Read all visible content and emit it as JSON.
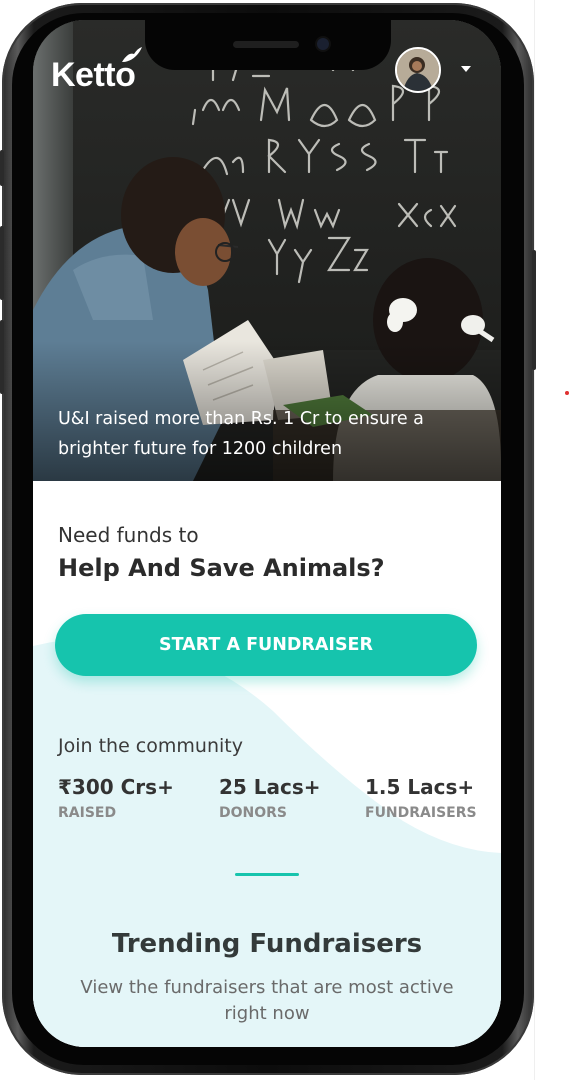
{
  "header": {
    "logo_text": "Ketto",
    "logo_icon": "bird-icon",
    "avatar_icon": "user-avatar",
    "menu_icon": "caret-down-icon"
  },
  "hero": {
    "caption": "U&I raised more than Rs. 1 Cr to ensure a brighter future for 1200 children"
  },
  "cta": {
    "prompt": "Need funds to",
    "cause": "Help And Save Animals?",
    "button_label": "START A FUNDRAISER"
  },
  "community": {
    "heading": "Join the community",
    "stats": [
      {
        "value": "₹300 Crs+",
        "label": "RAISED"
      },
      {
        "value": "25 Lacs+",
        "label": "DONORS"
      },
      {
        "value": "1.5 Lacs+",
        "label": "FUNDRAISERS"
      }
    ]
  },
  "trending": {
    "title": "Trending Fundraisers",
    "subtitle": "View the fundraisers that are most active right now"
  },
  "colors": {
    "accent": "#16c4ad",
    "wave": "#e4f6f8"
  }
}
